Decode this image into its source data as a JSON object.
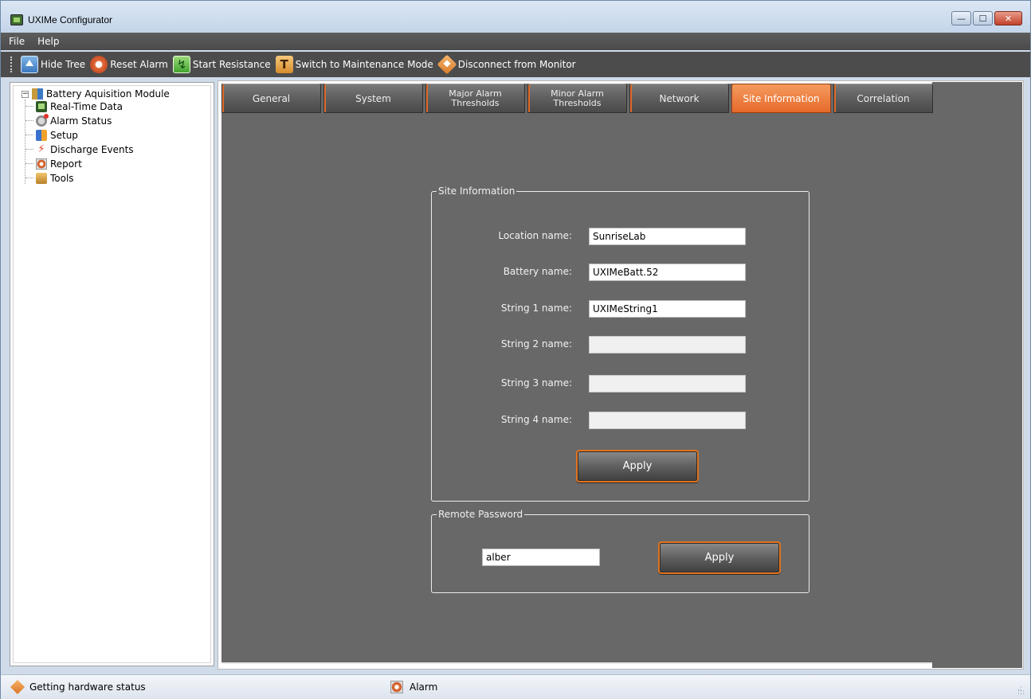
{
  "window": {
    "title": "UXIMe Configurator",
    "controls": {
      "minimize": "—",
      "maximize": "☐",
      "close": "✕"
    }
  },
  "menubar": {
    "items": [
      "File",
      "Help"
    ]
  },
  "toolbar": {
    "buttons": [
      {
        "label": "Hide Tree",
        "icon": "hide-tree-icon"
      },
      {
        "label": "Reset Alarm",
        "icon": "reset-alarm-icon"
      },
      {
        "label": "Start Resistance",
        "icon": "resistance-icon"
      },
      {
        "label": "Switch to Maintenance Mode",
        "icon": "maintenance-icon"
      },
      {
        "label": "Disconnect from Monitor",
        "icon": "disconnect-icon"
      }
    ]
  },
  "tree": {
    "root": {
      "label": "Battery Aquisition Module",
      "expander": "−"
    },
    "children": [
      {
        "label": "Real-Time Data",
        "icon": "realtime-data-icon"
      },
      {
        "label": "Alarm Status",
        "icon": "alarm-status-icon"
      },
      {
        "label": "Setup",
        "icon": "setup-icon"
      },
      {
        "label": "Discharge Events",
        "icon": "lightning-icon"
      },
      {
        "label": "Report",
        "icon": "report-icon"
      },
      {
        "label": "Tools",
        "icon": "toolbox-icon"
      }
    ]
  },
  "tabs": {
    "items": [
      {
        "label": "General"
      },
      {
        "label": "System"
      },
      {
        "label": "Major Alarm Thresholds",
        "line1": "Major Alarm",
        "line2": "Thresholds"
      },
      {
        "label": "Minor Alarm Thresholds",
        "line1": "Minor Alarm",
        "line2": "Thresholds"
      },
      {
        "label": "Network"
      },
      {
        "label": "Site Information"
      },
      {
        "label": "Correlation"
      }
    ],
    "active": "Site Information"
  },
  "site_info": {
    "group_title": "Site Information",
    "fields": [
      {
        "label": "Location name:",
        "value": "SunriseLab",
        "enabled": true
      },
      {
        "label": "Battery name:",
        "value": "UXIMeBatt.52",
        "enabled": true
      },
      {
        "label": "String 1 name:",
        "value": "UXIMeString1",
        "enabled": true
      },
      {
        "label": "String 2 name:",
        "value": "",
        "enabled": false
      },
      {
        "label": "String 3 name:",
        "value": "",
        "enabled": false
      },
      {
        "label": "String 4 name:",
        "value": "",
        "enabled": false
      }
    ],
    "apply_label": "Apply"
  },
  "remote_password": {
    "group_title": "Remote Password",
    "value": "alber",
    "apply_label": "Apply"
  },
  "statusbar": {
    "hardware_status": "Getting hardware status",
    "alarm_label": "Alarm"
  },
  "colors": {
    "accent": "#e66a2a",
    "panel": "#686868",
    "toolbar": "#4c4c4c"
  }
}
